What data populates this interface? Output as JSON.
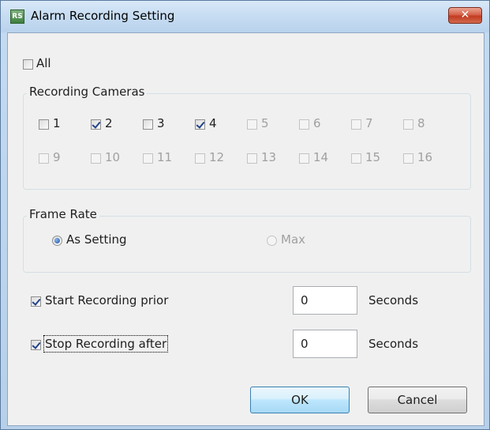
{
  "window": {
    "title": "Alarm Recording Setting",
    "icon": "rs-app-icon",
    "icon_text": "RS",
    "close_glyph": "✕"
  },
  "all_checkbox": {
    "label": "All",
    "checked": false
  },
  "recording_cameras": {
    "legend": "Recording Cameras",
    "cameras": [
      {
        "label": "1",
        "checked": false,
        "enabled": true
      },
      {
        "label": "2",
        "checked": true,
        "enabled": true
      },
      {
        "label": "3",
        "checked": false,
        "enabled": true
      },
      {
        "label": "4",
        "checked": true,
        "enabled": true
      },
      {
        "label": "5",
        "checked": false,
        "enabled": false
      },
      {
        "label": "6",
        "checked": false,
        "enabled": false
      },
      {
        "label": "7",
        "checked": false,
        "enabled": false
      },
      {
        "label": "8",
        "checked": false,
        "enabled": false
      },
      {
        "label": "9",
        "checked": false,
        "enabled": false
      },
      {
        "label": "10",
        "checked": false,
        "enabled": false
      },
      {
        "label": "11",
        "checked": false,
        "enabled": false
      },
      {
        "label": "12",
        "checked": false,
        "enabled": false
      },
      {
        "label": "13",
        "checked": false,
        "enabled": false
      },
      {
        "label": "14",
        "checked": false,
        "enabled": false
      },
      {
        "label": "15",
        "checked": false,
        "enabled": false
      },
      {
        "label": "16",
        "checked": false,
        "enabled": false
      }
    ]
  },
  "frame_rate": {
    "legend": "Frame Rate",
    "options": [
      {
        "label": "As Setting",
        "selected": true,
        "enabled": true
      },
      {
        "label": "Max",
        "selected": false,
        "enabled": false
      }
    ]
  },
  "start_prior": {
    "label": "Start Recording prior",
    "checked": true,
    "value": "0",
    "unit": "Seconds"
  },
  "stop_after": {
    "label": "Stop Recording after",
    "checked": true,
    "value": "0",
    "unit": "Seconds"
  },
  "buttons": {
    "ok": "OK",
    "cancel": "Cancel"
  }
}
